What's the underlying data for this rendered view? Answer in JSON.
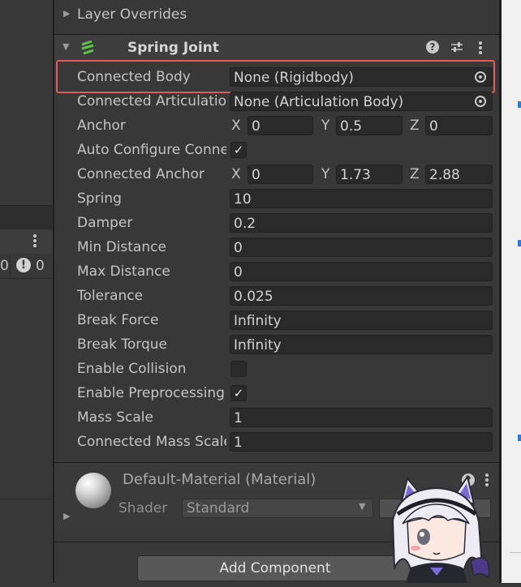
{
  "left_panel": {
    "count_a": "0",
    "count_b": "0",
    "menu_icon": "vertical-ellipsis"
  },
  "layer_overrides": {
    "label": "Layer Overrides"
  },
  "spring_joint": {
    "title": "Spring Joint",
    "icons": [
      "help-icon",
      "preset-icon",
      "menu-icon"
    ],
    "rows": {
      "connected_body": {
        "label": "Connected Body",
        "value": "None (Rigidbody)"
      },
      "connected_articulation": {
        "label": "Connected Articulation Body",
        "value": "None (Articulation Body)"
      },
      "anchor": {
        "label": "Anchor",
        "x": "0",
        "y": "0.5",
        "z": "0"
      },
      "auto_configure": {
        "label": "Auto Configure Connected Anchor",
        "checked": true
      },
      "connected_anchor": {
        "label": "Connected Anchor",
        "x": "0",
        "y": "1.73",
        "z": "2.88"
      },
      "spring": {
        "label": "Spring",
        "value": "10"
      },
      "damper": {
        "label": "Damper",
        "value": "0.2"
      },
      "min_distance": {
        "label": "Min Distance",
        "value": "0"
      },
      "max_distance": {
        "label": "Max Distance",
        "value": "0"
      },
      "tolerance": {
        "label": "Tolerance",
        "value": "0.025"
      },
      "break_force": {
        "label": "Break Force",
        "value": "Infinity"
      },
      "break_torque": {
        "label": "Break Torque",
        "value": "Infinity"
      },
      "enable_collision": {
        "label": "Enable Collision",
        "checked": false
      },
      "enable_preprocessing": {
        "label": "Enable Preprocessing",
        "checked": true
      },
      "mass_scale": {
        "label": "Mass Scale",
        "value": "1"
      },
      "connected_mass_scale": {
        "label": "Connected Mass Scale",
        "value": "1"
      }
    },
    "axis_labels": {
      "x": "X",
      "y": "Y",
      "z": "Z"
    }
  },
  "material": {
    "title": "Default-Material (Material)",
    "shader_label": "Shader",
    "shader_value": "Standard"
  },
  "add_component": {
    "label": "Add Component"
  },
  "colors": {
    "highlight": "#e05a5f",
    "spring_icon": "#5fc24a",
    "accent_blue": "#2a7bd8"
  }
}
